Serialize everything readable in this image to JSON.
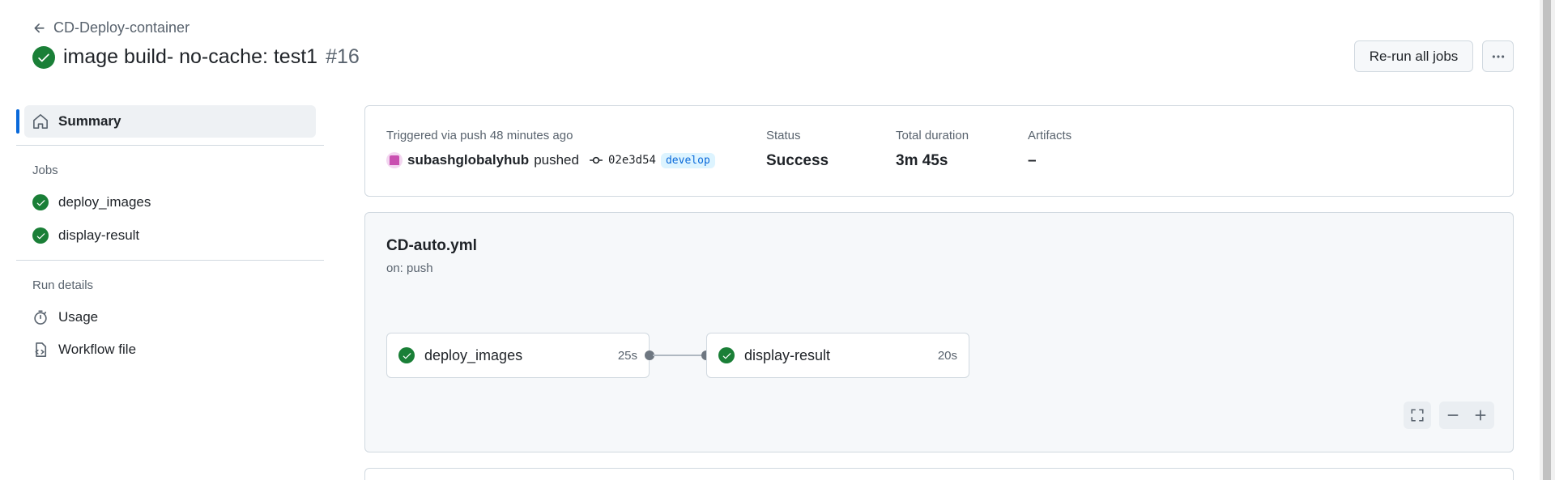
{
  "header": {
    "back_label": "CD-Deploy-container",
    "title": "image build- no-cache: test1",
    "run_number": "#16",
    "rerun_label": "Re-run all jobs",
    "more_label": "···"
  },
  "sidebar": {
    "summary_label": "Summary",
    "jobs_heading": "Jobs",
    "jobs": [
      {
        "label": "deploy_images",
        "status": "success"
      },
      {
        "label": "display-result",
        "status": "success"
      }
    ],
    "run_details_heading": "Run details",
    "details": [
      {
        "label": "Usage",
        "icon": "stopwatch-icon"
      },
      {
        "label": "Workflow file",
        "icon": "file-code-icon"
      }
    ]
  },
  "info": {
    "trigger_label": "Triggered via push 48 minutes ago",
    "user": "subashglobalyhub",
    "action": "pushed",
    "commit_sha": "02e3d54",
    "branch": "develop",
    "status_label": "Status",
    "status_value": "Success",
    "duration_label": "Total duration",
    "duration_value": "3m 45s",
    "artifacts_label": "Artifacts",
    "artifacts_value": "–"
  },
  "workflow": {
    "file": "CD-auto.yml",
    "on": "on: push",
    "jobs": [
      {
        "name": "deploy_images",
        "duration": "25s"
      },
      {
        "name": "display-result",
        "duration": "20s"
      }
    ]
  },
  "colors": {
    "success": "#1a7f37",
    "accent": "#0969da",
    "border": "#d1d9e0"
  }
}
